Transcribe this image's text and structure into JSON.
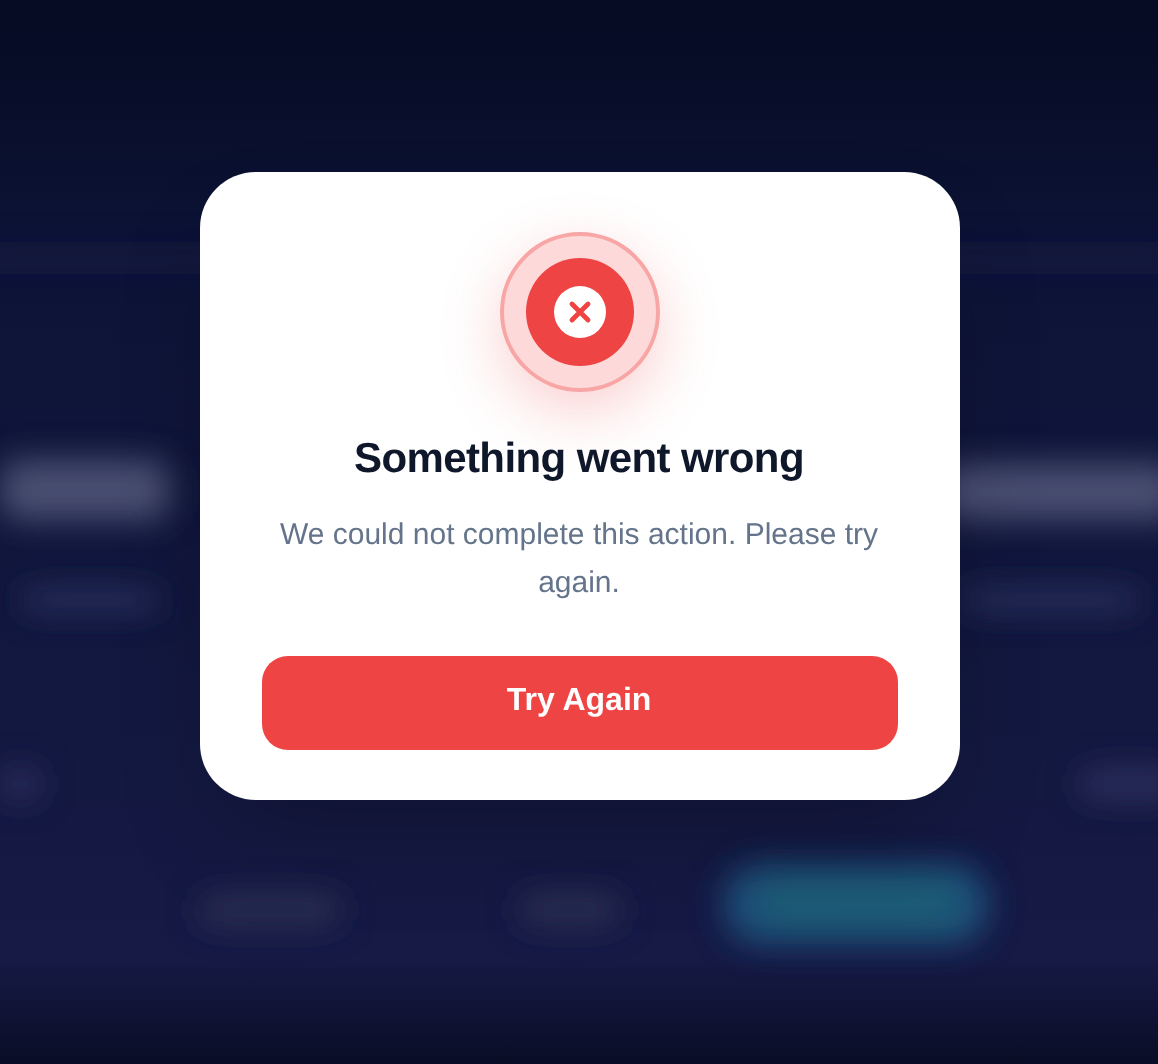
{
  "dialog": {
    "kind": "error",
    "title": "Something went wrong",
    "message": "We could not complete this action. Please try again.",
    "button": "Try Again"
  }
}
